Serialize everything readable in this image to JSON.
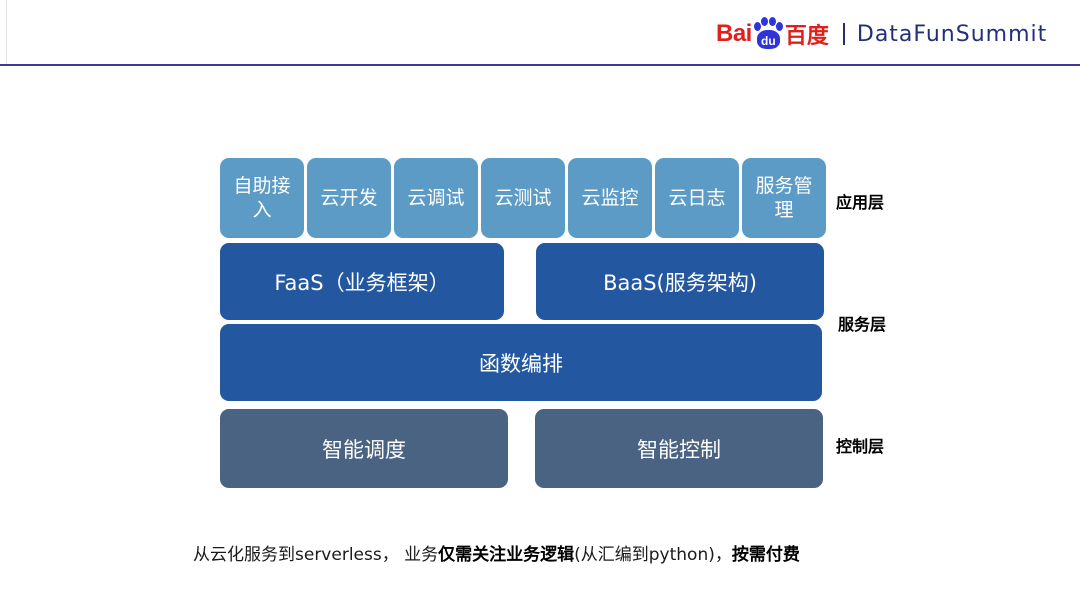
{
  "header": {
    "logo_bai": "Bai",
    "logo_du": "du",
    "logo_cn": "百度",
    "brand_text": "DataFunSummit",
    "accent_color": "#3d3a9e"
  },
  "diagram": {
    "app_layer": {
      "label": "应用层",
      "items": [
        "自助接入",
        "云开发",
        "云调试",
        "云测试",
        "云监控",
        "云日志",
        "服务管理"
      ]
    },
    "service_layer": {
      "label": "服务层",
      "faas": "FaaS（业务框架）",
      "baas": "BaaS(服务架构)",
      "orchestration": "函数编排"
    },
    "control_layer": {
      "label": "控制层",
      "scheduling": "智能调度",
      "control": "智能控制"
    },
    "colors": {
      "app": "#5b9bc6",
      "service": "#23579f",
      "control": "#4a6383"
    }
  },
  "footer": {
    "part1": "从云化服务到serverless， 业务",
    "part2_bold": "仅需关注业务逻辑",
    "part3": "(从汇编到python)，",
    "part4_bold": "按需付费"
  }
}
